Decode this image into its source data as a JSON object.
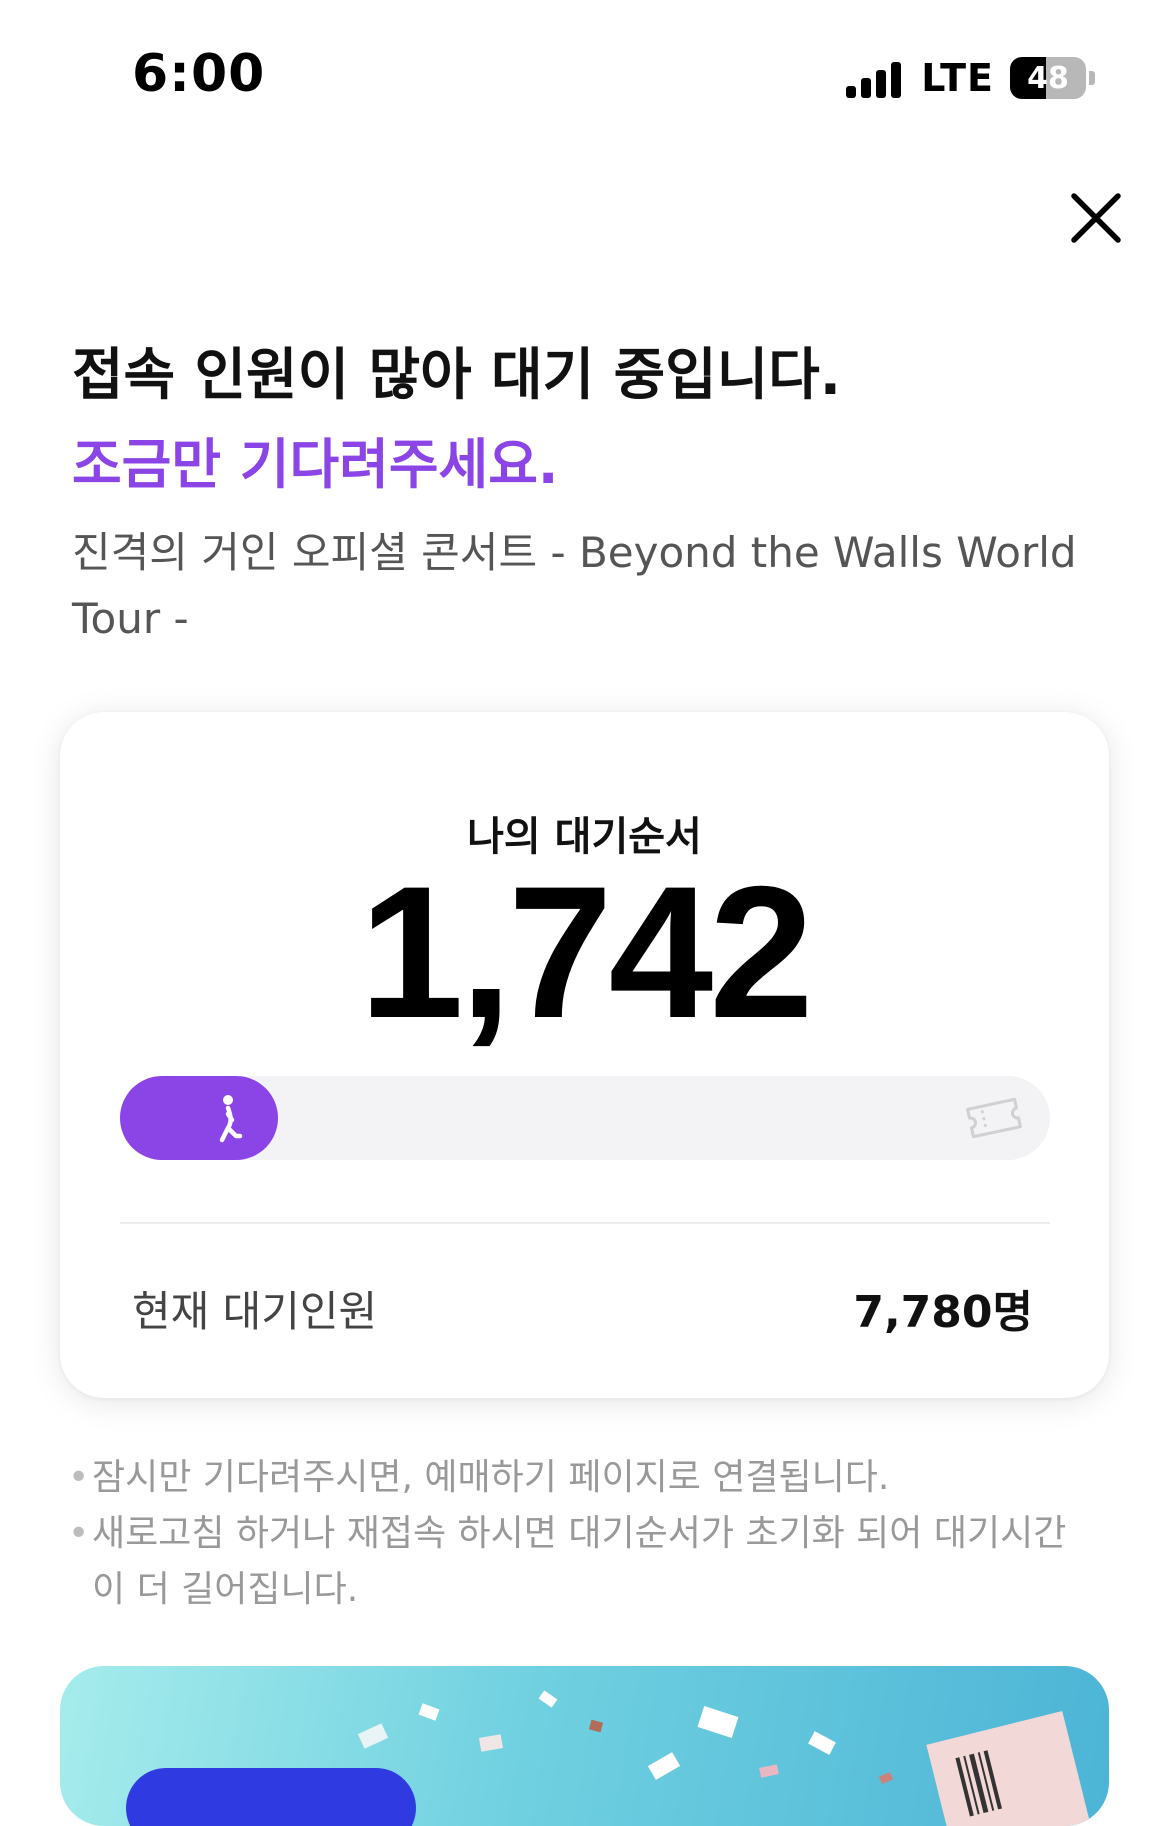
{
  "status_bar": {
    "time": "6:00",
    "network": "LTE",
    "battery": "48",
    "battery_level_percent": 48
  },
  "header": {
    "close_icon": "close-icon"
  },
  "headline": "접속 인원이 많아 대기 중입니다.",
  "subheadline": "조금만 기다려주세요.",
  "event_title": "진격의 거인 오피셜 콘서트 - Beyond the Walls World Tour -",
  "queue_card": {
    "label": "나의 대기순서",
    "position": "1,742",
    "progress_percent": 17,
    "progress_icon": "walking-person-icon",
    "goal_icon": "ticket-icon",
    "count_label": "현재 대기인원",
    "count_value": "7,780명"
  },
  "notes": [
    "잠시만 기다려주시면, 예매하기 페이지로 연결됩니다.",
    "새로고침 하거나 재접속 하시면 대기순서가 초기화 되어 대기시간이 더 길어집니다."
  ],
  "colors": {
    "accent": "#8b45e6",
    "progress_track": "#f3f3f5",
    "promo_button": "#2f3be0"
  }
}
